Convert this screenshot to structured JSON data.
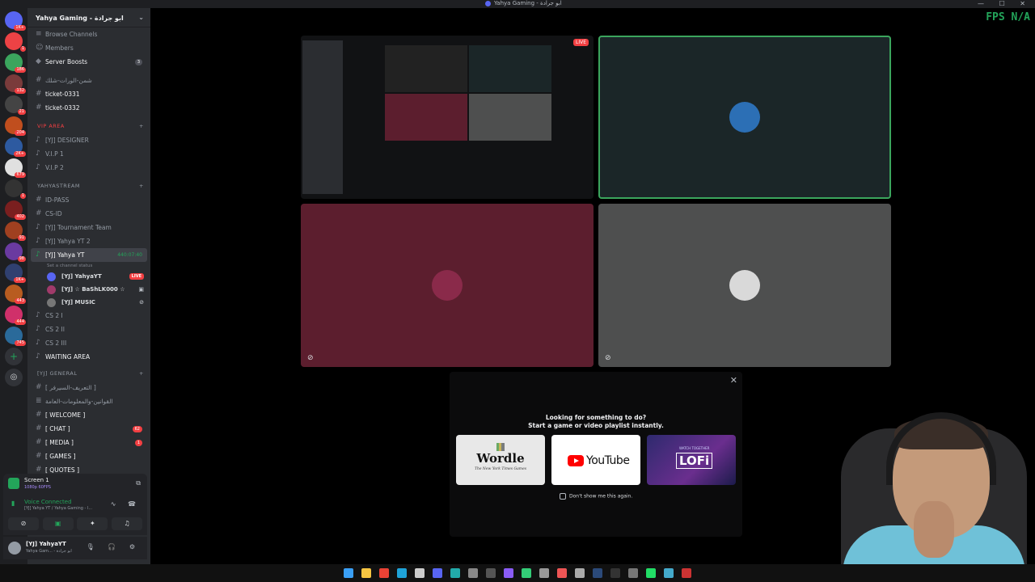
{
  "window": {
    "title": "Yahya Gaming - ابو جرادة"
  },
  "overlay": {
    "fps": "FPS N/A"
  },
  "server_list": [
    {
      "badge": "1K+"
    },
    {
      "badge": "1"
    },
    {
      "badge": "186"
    },
    {
      "badge": "132"
    },
    {
      "badge": "21"
    },
    {
      "badge": "204"
    },
    {
      "badge": "2K+"
    },
    {
      "badge": "679"
    },
    {
      "badge": "1"
    },
    {
      "badge": "402"
    },
    {
      "badge": "91"
    },
    {
      "badge": "98"
    },
    {
      "badge": "1K+"
    },
    {
      "badge": "443"
    },
    {
      "badge": "444"
    },
    {
      "badge": "745"
    }
  ],
  "guild": {
    "name": "Yahya Gaming - ابو جرادة"
  },
  "channels": {
    "browse": "Browse Channels",
    "members": "Members",
    "server_boosts": "Server Boosts",
    "server_boosts_count": "3",
    "items_top": [
      "شمن-الورات-شلك",
      "ticket-0331",
      "ticket-0332"
    ],
    "vip_category": "VIP AREA",
    "vip_items": [
      "[YJ] DESIGNER",
      "V.I.P 1",
      "V.I.P 2"
    ],
    "stream_category": "YAHYASTREAM",
    "stream_items": [
      "ID-PASS",
      "CS-ID",
      "[YJ] Tournament Team",
      "[YJ] Yahya YT 2"
    ],
    "active_voice": "[YJ] Yahya YT",
    "active_timer": "440:07:40",
    "channel_status": "Set a channel status",
    "voice_users": [
      {
        "name": "[YJ] YahyaYT",
        "live": "LIVE"
      },
      {
        "name": "[YJ] ☆ BaShLK000 ☆"
      },
      {
        "name": "[YJ] MUSIC"
      }
    ],
    "cs_items": [
      "CS 2 I",
      "CS 2 II",
      "CS 2 III",
      "WAITING AREA"
    ],
    "general_category": "[YJ] GENERAL",
    "general_items": [
      {
        "label": "[ التعريف-السيرفر ]"
      },
      {
        "label": "القوانين-والمعلومات-العامة"
      },
      {
        "label": "[ WELCOME ]"
      },
      {
        "label": "[ CHAT ]",
        "count": "62"
      },
      {
        "label": "[ MEDIA ]",
        "count": "1"
      },
      {
        "label": "[ GAMES ]"
      },
      {
        "label": "[ QUOTES ]"
      }
    ]
  },
  "screen_panel": {
    "label": "Screen 1",
    "sub": "1080p 60FPS"
  },
  "voice_panel": {
    "status": "Voice Connected",
    "channel": "[YJ] Yahya YT / Yahya Gaming - ا..."
  },
  "user_panel": {
    "name": "[YJ] YahyaYT",
    "status": "Yahya Gam... - ابو جرادة"
  },
  "stream_tiles": [
    {
      "live": "LIVE"
    },
    {},
    {},
    {}
  ],
  "activity": {
    "heading": "Looking for something to do?",
    "subheading": "Start a game or video playlist instantly.",
    "cards": [
      {
        "title": "Wordle",
        "subtitle": "The New York Times Games"
      },
      {
        "title": "YouTube"
      },
      {
        "title": "LOFi",
        "subtitle": "WATCH TOGETHER"
      }
    ],
    "dont_show": "Don't show me this again."
  },
  "colors": {
    "accent": "#5865f2",
    "online": "#23a55a",
    "live": "#f23f42"
  }
}
